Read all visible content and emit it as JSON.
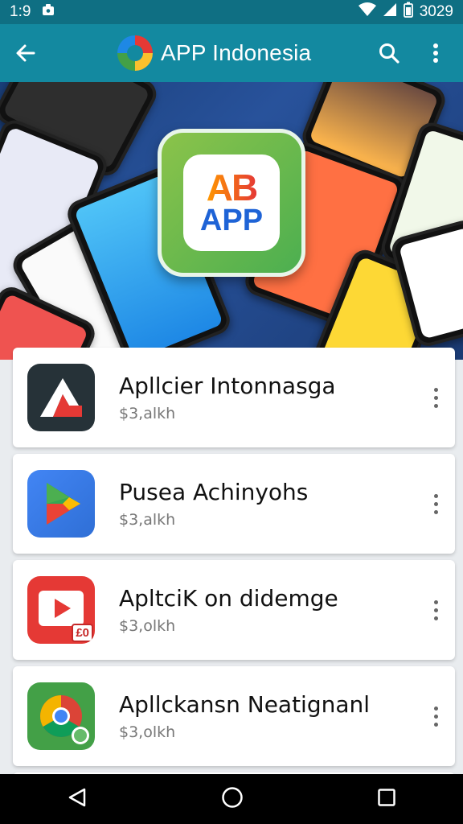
{
  "status_bar": {
    "time": "1:9",
    "battery_text": "3029"
  },
  "app_bar": {
    "title": "APP Indonesia",
    "icons": [
      "back-arrow-icon",
      "search-icon",
      "overflow-menu-icon"
    ]
  },
  "hero": {
    "badge_top": "AB",
    "badge_bottom": "APP"
  },
  "apps": [
    {
      "name": "Apllcier Intonnasga",
      "price": "$3,alkh",
      "icon": "red-white-logo-icon",
      "color": "#d32f2f"
    },
    {
      "name": "Pusea Achinyohs",
      "price": "$3,alkh",
      "icon": "play-triangle-icon",
      "color": "#2f80ed"
    },
    {
      "name": "ApltciK on didemge",
      "price": "$3,olkh",
      "icon": "video-play-icon",
      "color": "#e53935",
      "badge": "£0"
    },
    {
      "name": "Apllckansn Neatignanl",
      "price": "$3,olkh",
      "icon": "chrome-like-icon",
      "color": "#43a047"
    }
  ],
  "nav_bar": {
    "icons": [
      "nav-back-icon",
      "nav-home-icon",
      "nav-recents-icon"
    ]
  }
}
